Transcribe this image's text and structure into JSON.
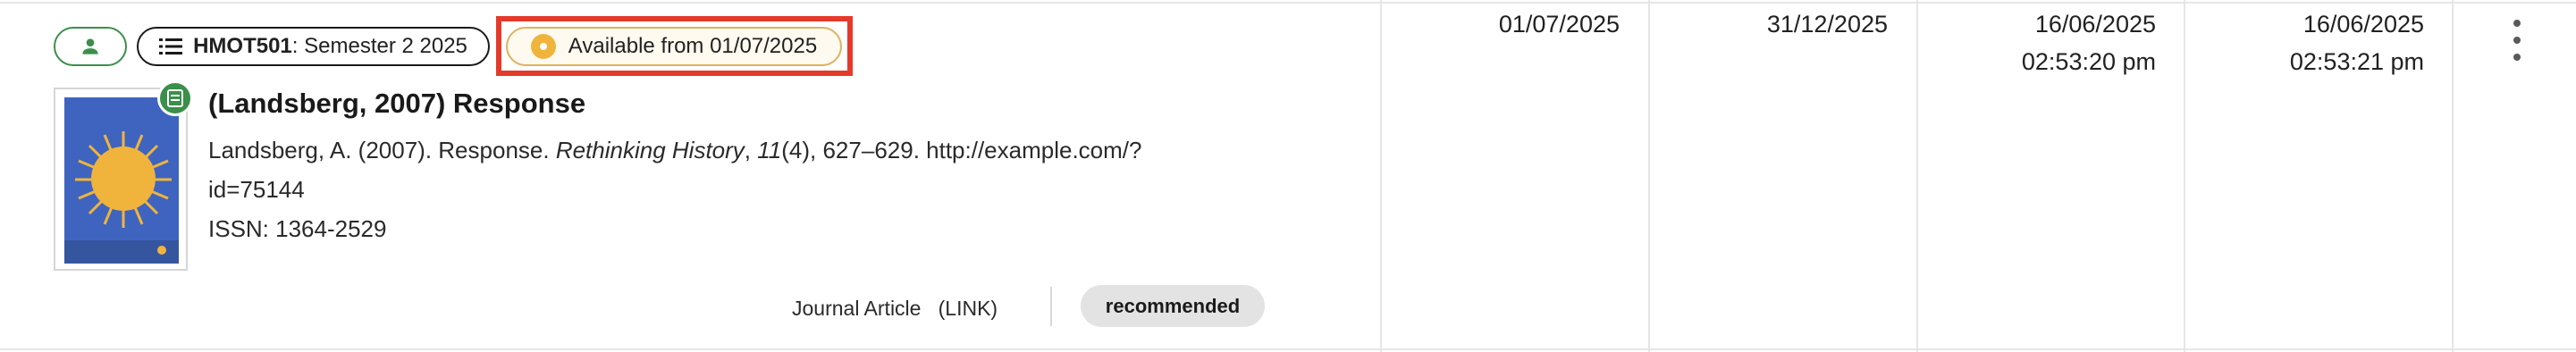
{
  "chips": {
    "module_code": "HMOT501",
    "module_term": ": Semester 2 2025",
    "availability": "Available from 01/07/2025"
  },
  "item": {
    "title": "(Landsberg, 2007) Response",
    "citation_prefix": "Landsberg, A. (2007). Response. ",
    "citation_journal": "Rethinking History",
    "citation_sep": ", ",
    "citation_volume": "11",
    "citation_rest": "(4), 627–629. http://example.com/?",
    "citation_line2": "id=75144",
    "issn": "ISSN: 1364-2529",
    "type": "Journal Article",
    "link": "(LINK)",
    "importance": "recommended"
  },
  "columns": {
    "start_date": "01/07/2025",
    "end_date": "31/12/2025",
    "created_date": "16/06/2025",
    "created_time": "02:53:20 pm",
    "updated_date": "16/06/2025",
    "updated_time": "02:53:21 pm"
  },
  "colors": {
    "accent_green": "#3a8f4a",
    "availability_amber": "#f0b43c",
    "highlight_red": "#e53a2a"
  },
  "icons": [
    "person-icon",
    "list-icon",
    "availability-dot-icon",
    "document-badge-icon",
    "more-vert-icon"
  ]
}
